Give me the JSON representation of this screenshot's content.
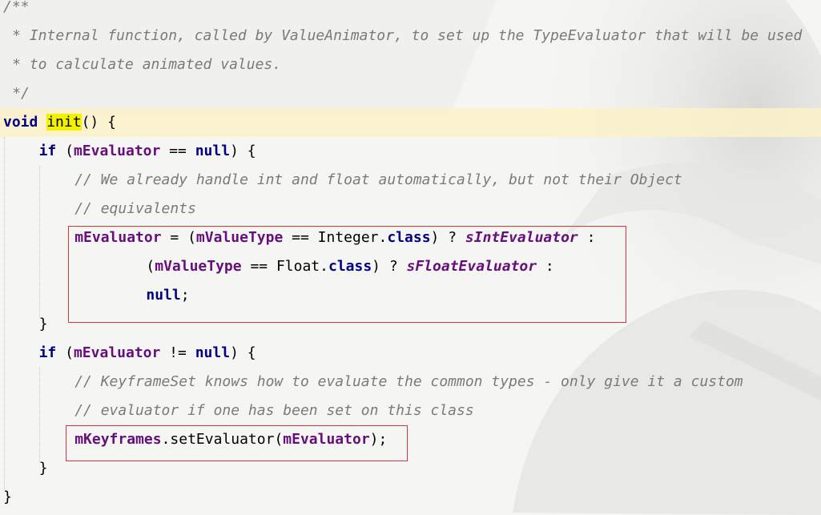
{
  "editor": {
    "lines": [
      {
        "indent": "",
        "tokens": [
          {
            "t": "/**",
            "c": "comment"
          }
        ]
      },
      {
        "indent": " ",
        "tokens": [
          {
            "t": "* Internal function, called by ValueAnimator, to set up the TypeEvaluator that will be used",
            "c": "comment"
          }
        ]
      },
      {
        "indent": " ",
        "tokens": [
          {
            "t": "* to calculate animated values.",
            "c": "comment"
          }
        ]
      },
      {
        "indent": " ",
        "tokens": [
          {
            "t": "*/",
            "c": "comment"
          }
        ]
      },
      {
        "indent": "",
        "current": true,
        "tokens": [
          {
            "t": "void",
            "c": "kw"
          },
          {
            "t": " "
          },
          {
            "t": "init",
            "c": "hl"
          },
          {
            "t": "() {"
          }
        ]
      },
      {
        "indent": "    ",
        "tokens": [
          {
            "t": "if",
            "c": "kw"
          },
          {
            "t": " ("
          },
          {
            "t": "mEvaluator",
            "c": "field"
          },
          {
            "t": " == "
          },
          {
            "t": "null",
            "c": "kw"
          },
          {
            "t": ") {"
          }
        ]
      },
      {
        "indent": "        ",
        "tokens": [
          {
            "t": "// We already handle int and float automatically, but not their Object",
            "c": "comment"
          }
        ]
      },
      {
        "indent": "        ",
        "tokens": [
          {
            "t": "// equivalents",
            "c": "comment"
          }
        ]
      },
      {
        "indent": "        ",
        "tokens": [
          {
            "t": "mEvaluator",
            "c": "field"
          },
          {
            "t": " = ("
          },
          {
            "t": "mValueType",
            "c": "field"
          },
          {
            "t": " == Integer."
          },
          {
            "t": "class",
            "c": "kw"
          },
          {
            "t": ") ? "
          },
          {
            "t": "sIntEvaluator",
            "c": "static"
          },
          {
            "t": " :"
          }
        ]
      },
      {
        "indent": "                ",
        "tokens": [
          {
            "t": "("
          },
          {
            "t": "mValueType",
            "c": "field"
          },
          {
            "t": " == Float."
          },
          {
            "t": "class",
            "c": "kw"
          },
          {
            "t": ") ? "
          },
          {
            "t": "sFloatEvaluator",
            "c": "static"
          },
          {
            "t": " :"
          }
        ]
      },
      {
        "indent": "                ",
        "tokens": [
          {
            "t": "null",
            "c": "kw"
          },
          {
            "t": ";"
          }
        ]
      },
      {
        "indent": "    ",
        "tokens": [
          {
            "t": "}"
          }
        ]
      },
      {
        "indent": "    ",
        "tokens": [
          {
            "t": "if",
            "c": "kw"
          },
          {
            "t": " ("
          },
          {
            "t": "mEvaluator",
            "c": "field"
          },
          {
            "t": " != "
          },
          {
            "t": "null",
            "c": "kw"
          },
          {
            "t": ") {"
          }
        ]
      },
      {
        "indent": "        ",
        "tokens": [
          {
            "t": "// KeyframeSet knows how to evaluate the common types - only give it a custom",
            "c": "comment"
          }
        ]
      },
      {
        "indent": "        ",
        "tokens": [
          {
            "t": "// evaluator if one has been set on this class",
            "c": "comment"
          }
        ]
      },
      {
        "indent": "        ",
        "tokens": [
          {
            "t": "mKeyframes",
            "c": "field"
          },
          {
            "t": ".setEvaluator("
          },
          {
            "t": "mEvaluator",
            "c": "field"
          },
          {
            "t": ");"
          }
        ]
      },
      {
        "indent": "    ",
        "tokens": [
          {
            "t": "}"
          }
        ]
      },
      {
        "indent": "",
        "tokens": [
          {
            "t": "}"
          }
        ]
      }
    ]
  },
  "colors": {
    "keyword": "#000080",
    "comment": "#7a7a7a",
    "field": "#660e7a",
    "identifier_highlight": "#f2f200",
    "current_line": "#fcf2c8",
    "annotation_box": "#d9343a"
  }
}
